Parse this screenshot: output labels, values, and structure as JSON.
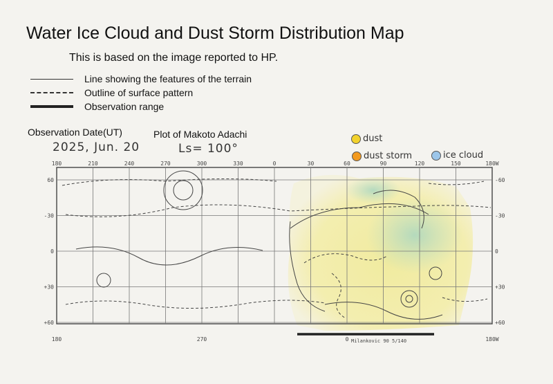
{
  "title": "Water Ice Cloud and Dust Storm Distribution Map",
  "subtitle": "This is based on the image reported to HP.",
  "legend": [
    {
      "label": "Line showing the features of the terrain"
    },
    {
      "label": "Outline of surface pattern"
    },
    {
      "label": "Observation range"
    }
  ],
  "observation_date_label": "Observation Date(UT)",
  "observation_date": "2025, Jun. 20",
  "plotter_label": "Plot of Makoto Adachi",
  "solar_longitude": "Ls= 100°",
  "markers": [
    {
      "label": "dust",
      "color": "#f2d22c"
    },
    {
      "label": "dust storm",
      "color": "#f39a1e"
    },
    {
      "label": "ice cloud",
      "color": "#9cc6ea"
    }
  ],
  "map": {
    "top_longitudes": [
      "180",
      "210",
      "240",
      "270",
      "300",
      "330",
      "0",
      "30",
      "60",
      "90",
      "120",
      "150",
      "180W"
    ],
    "bottom_longitudes": [
      "180",
      "270",
      "0",
      "180W"
    ],
    "latitudes_left": [
      "60",
      "-30",
      "0",
      "+30",
      "+60"
    ],
    "latitudes_right": [
      "-60",
      "-30",
      "0",
      "+30",
      "+60"
    ],
    "bottom_annotation": "Milankovic 90 5/140",
    "shading_colors": {
      "dust": "#f3ec9a",
      "cloud": "#b9dcc6"
    }
  }
}
